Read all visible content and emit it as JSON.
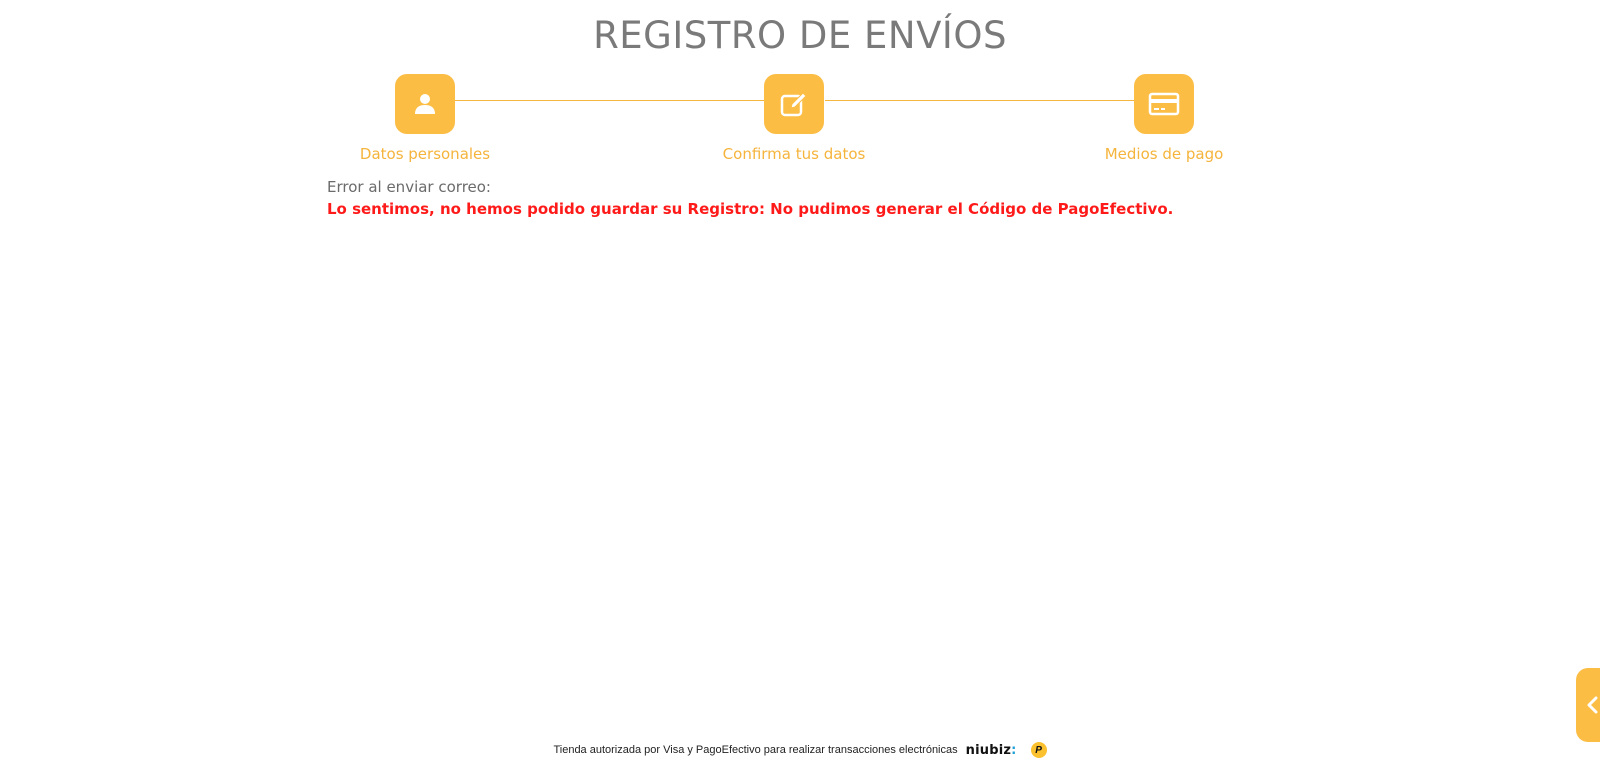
{
  "header": {
    "title": "REGISTRO DE ENVÍOS"
  },
  "steps": [
    {
      "label": "Datos personales",
      "icon": "user-icon"
    },
    {
      "label": "Confirma tus datos",
      "icon": "edit-icon"
    },
    {
      "label": "Medios de pago",
      "icon": "credit-card-icon"
    }
  ],
  "colors": {
    "accent": "#fbbd44",
    "error": "#ff1a1a",
    "muted_text": "#6b6b6b"
  },
  "message": {
    "label": "Error al enviar correo:",
    "error": "Lo sentimos, no hemos podido guardar su Registro: No pudimos generar el Código de PagoEfectivo."
  },
  "footer": {
    "text": "Tienda autorizada por Visa y PagoEfectivo para realizar transacciones electrónicas",
    "niubiz": "niubiz",
    "niubiz_dots": ":",
    "pagoefectivo_mark": "P"
  },
  "side_tab": {
    "icon": "chevron-left-icon"
  }
}
